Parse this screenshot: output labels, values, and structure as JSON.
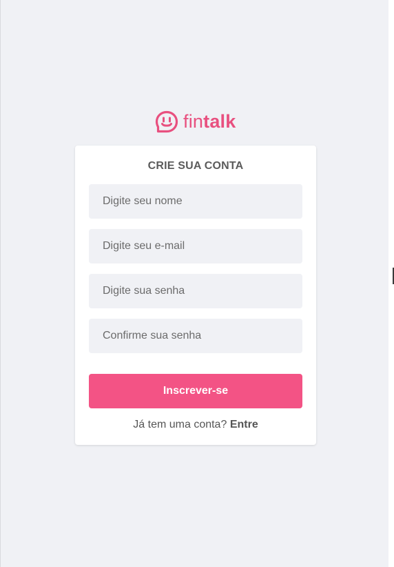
{
  "logo": {
    "text_light": "fin",
    "text_bold": "talk",
    "icon": "speech-bubble-smile-icon",
    "color": "#e8507f"
  },
  "form": {
    "title": "CRIE SUA CONTA",
    "name_placeholder": "Digite seu nome",
    "email_placeholder": "Digite seu e-mail",
    "password_placeholder": "Digite sua senha",
    "confirm_placeholder": "Confirme sua senha",
    "submit_label": "Inscrever-se",
    "submit_color": "#f35385"
  },
  "login": {
    "prompt": "Já tem uma conta?",
    "link_label": "Entre"
  }
}
